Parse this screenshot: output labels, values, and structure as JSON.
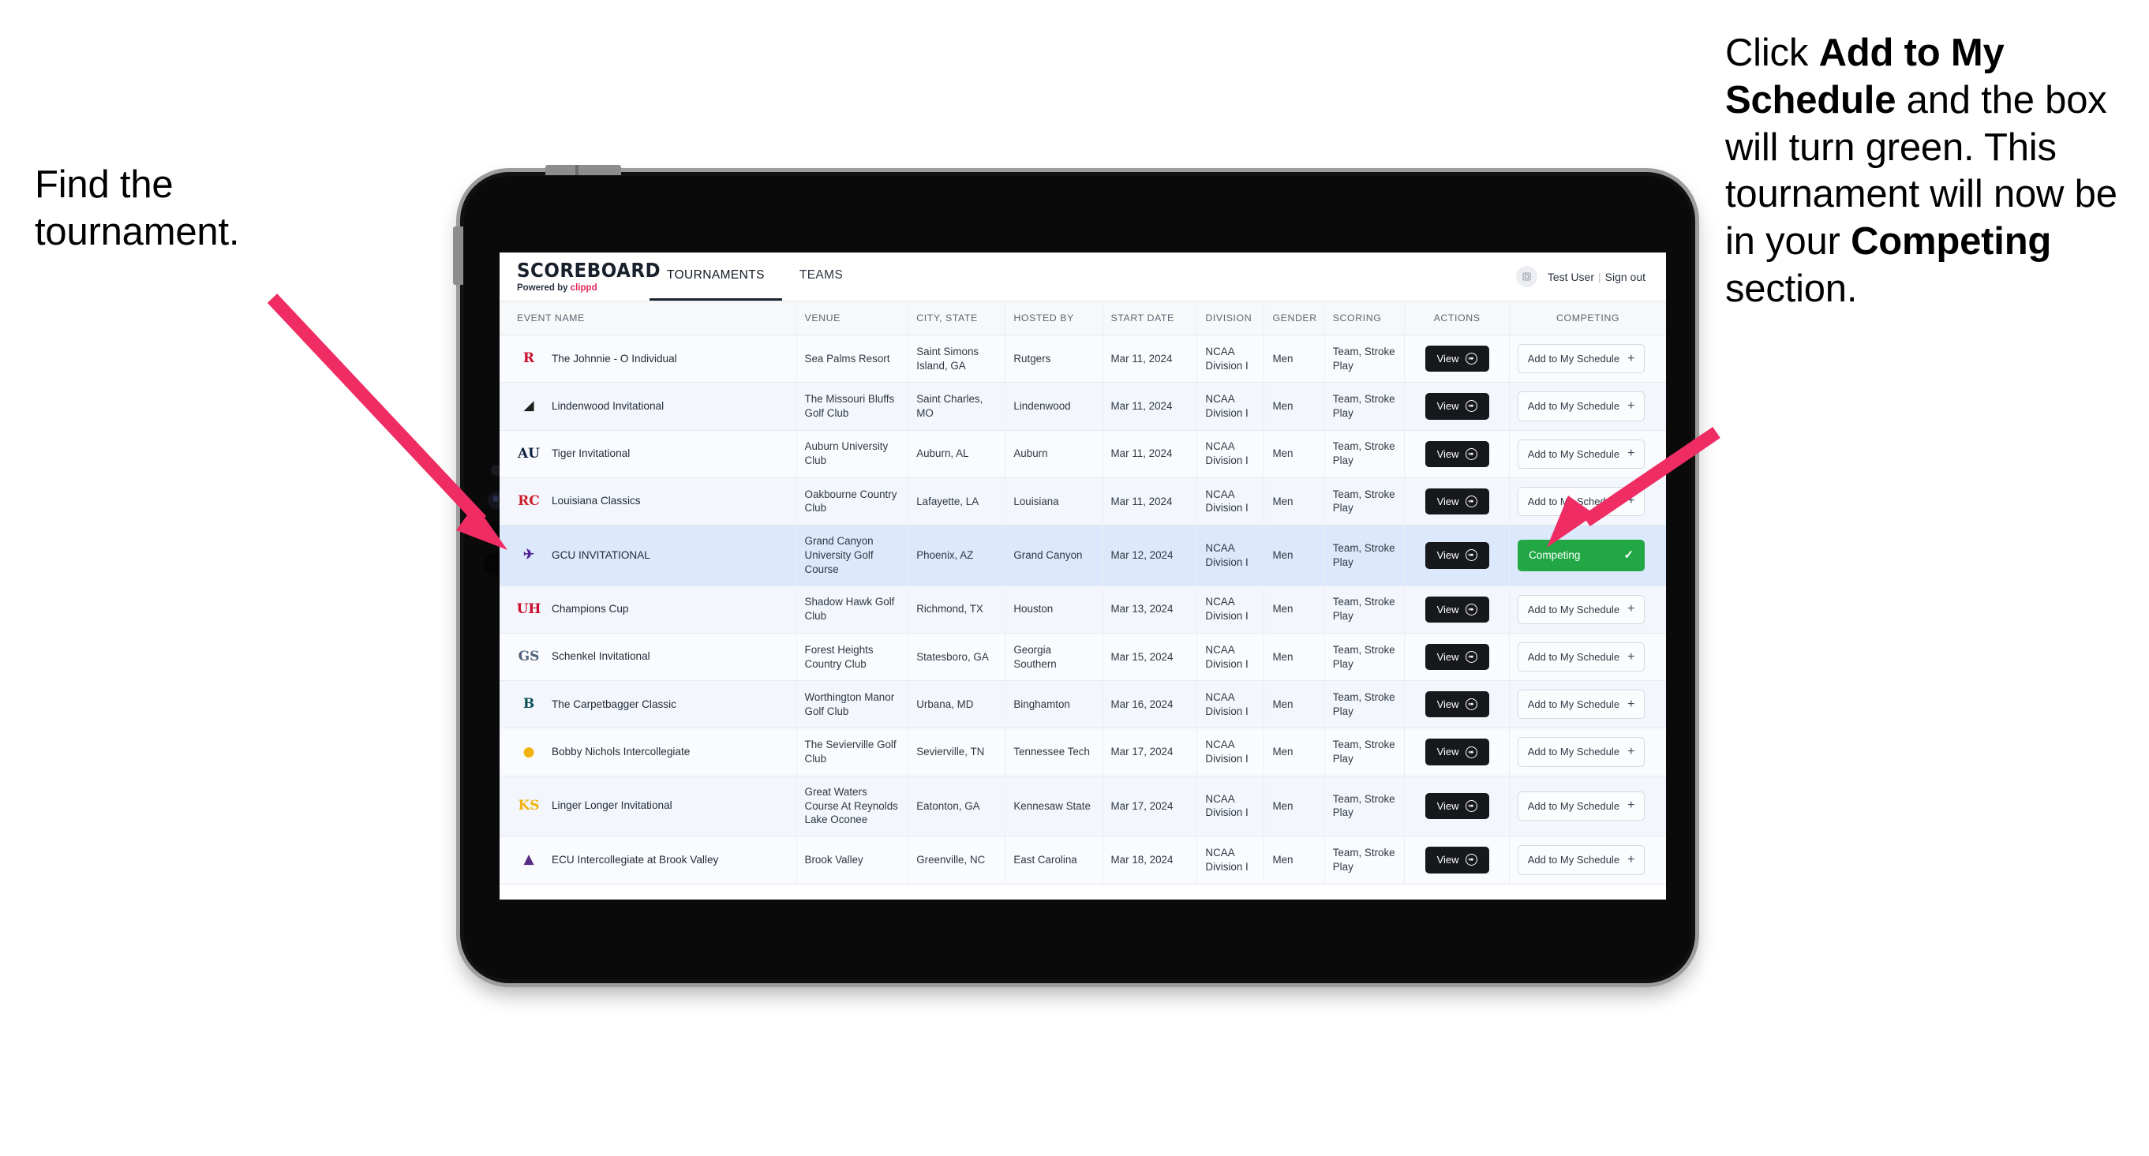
{
  "annotations": {
    "left": {
      "line1": "Find the",
      "line2": "tournament."
    },
    "right": {
      "pre": "Click ",
      "bold1": "Add to My Schedule",
      "mid": " and the box will turn green. This tournament will now be in your ",
      "bold2": "Competing",
      "post": " section."
    }
  },
  "app": {
    "brand": {
      "title": "SCOREBOARD",
      "powered_prefix": "Powered by ",
      "powered_name": "clippd"
    },
    "tabs": [
      {
        "label": "TOURNAMENTS",
        "active": true
      },
      {
        "label": "TEAMS",
        "active": false
      }
    ],
    "user": {
      "avatar_icon": "user-avatar-icon",
      "name": "Test User",
      "separator": "|",
      "sign_out": "Sign out"
    }
  },
  "table": {
    "columns": [
      "EVENT NAME",
      "VENUE",
      "CITY, STATE",
      "HOSTED BY",
      "START DATE",
      "DIVISION",
      "GENDER",
      "SCORING",
      "ACTIONS",
      "COMPETING"
    ],
    "action_label": "View",
    "add_label": "Add to My Schedule",
    "add_plus": "+",
    "competing_label": "Competing",
    "competing_check": "✓",
    "accent_green": "#22a745",
    "accent_pink": "#ef2c63",
    "selected_row_bg": "#dce8fb",
    "rows": [
      {
        "logo": {
          "text": "R",
          "color": "#c8102e",
          "bg": "transparent"
        },
        "event": "The Johnnie - O Individual",
        "venue": "Sea Palms Resort",
        "city": "Saint Simons Island, GA",
        "host": "Rutgers",
        "date": "Mar 11, 2024",
        "division": "NCAA Division I",
        "gender": "Men",
        "scoring": "Team, Stroke Play",
        "competing": false
      },
      {
        "logo": {
          "text": "◢",
          "color": "#1d1d1d",
          "bg": "transparent"
        },
        "event": "Lindenwood Invitational",
        "venue": "The Missouri Bluffs Golf Club",
        "city": "Saint Charles, MO",
        "host": "Lindenwood",
        "date": "Mar 11, 2024",
        "division": "NCAA Division I",
        "gender": "Men",
        "scoring": "Team, Stroke Play",
        "competing": false
      },
      {
        "logo": {
          "text": "AU",
          "color": "#0c2340",
          "bg": "transparent"
        },
        "event": "Tiger Invitational",
        "venue": "Auburn University Club",
        "city": "Auburn, AL",
        "host": "Auburn",
        "date": "Mar 11, 2024",
        "division": "NCAA Division I",
        "gender": "Men",
        "scoring": "Team, Stroke Play",
        "competing": false
      },
      {
        "logo": {
          "text": "RC",
          "color": "#ce2029",
          "bg": "transparent"
        },
        "event": "Louisiana Classics",
        "venue": "Oakbourne Country Club",
        "city": "Lafayette, LA",
        "host": "Louisiana",
        "date": "Mar 11, 2024",
        "division": "NCAA Division I",
        "gender": "Men",
        "scoring": "Team, Stroke Play",
        "competing": false
      },
      {
        "logo": {
          "text": "✈",
          "color": "#522398",
          "bg": "transparent"
        },
        "event": "GCU INVITATIONAL",
        "venue": "Grand Canyon University Golf Course",
        "city": "Phoenix, AZ",
        "host": "Grand Canyon",
        "date": "Mar 12, 2024",
        "division": "NCAA Division I",
        "gender": "Men",
        "scoring": "Team, Stroke Play",
        "competing": true,
        "selected": true
      },
      {
        "logo": {
          "text": "UH",
          "color": "#c8102e",
          "bg": "transparent"
        },
        "event": "Champions Cup",
        "venue": "Shadow Hawk Golf Club",
        "city": "Richmond, TX",
        "host": "Houston",
        "date": "Mar 13, 2024",
        "division": "NCAA Division I",
        "gender": "Men",
        "scoring": "Team, Stroke Play",
        "competing": false
      },
      {
        "logo": {
          "text": "GS",
          "color": "#4f6277",
          "bg": "transparent"
        },
        "event": "Schenkel Invitational",
        "venue": "Forest Heights Country Club",
        "city": "Statesboro, GA",
        "host": "Georgia Southern",
        "date": "Mar 15, 2024",
        "division": "NCAA Division I",
        "gender": "Men",
        "scoring": "Team, Stroke Play",
        "competing": false
      },
      {
        "logo": {
          "text": "B",
          "color": "#0d5257",
          "bg": "transparent"
        },
        "event": "The Carpetbagger Classic",
        "venue": "Worthington Manor Golf Club",
        "city": "Urbana, MD",
        "host": "Binghamton",
        "date": "Mar 16, 2024",
        "division": "NCAA Division I",
        "gender": "Men",
        "scoring": "Team, Stroke Play",
        "competing": false
      },
      {
        "logo": {
          "text": "●",
          "color": "#f0b310",
          "bg": "transparent"
        },
        "event": "Bobby Nichols Intercollegiate",
        "venue": "The Sevierville Golf Club",
        "city": "Sevierville, TN",
        "host": "Tennessee Tech",
        "date": "Mar 17, 2024",
        "division": "NCAA Division I",
        "gender": "Men",
        "scoring": "Team, Stroke Play",
        "competing": false
      },
      {
        "logo": {
          "text": "KS",
          "color": "#f0b310",
          "bg": "transparent"
        },
        "event": "Linger Longer Invitational",
        "venue": "Great Waters Course At Reynolds Lake Oconee",
        "city": "Eatonton, GA",
        "host": "Kennesaw State",
        "date": "Mar 17, 2024",
        "division": "NCAA Division I",
        "gender": "Men",
        "scoring": "Team, Stroke Play",
        "competing": false
      },
      {
        "logo": {
          "text": "▲",
          "color": "#582c83",
          "bg": "transparent"
        },
        "event": "ECU Intercollegiate at Brook Valley",
        "venue": "Brook Valley",
        "city": "Greenville, NC",
        "host": "East Carolina",
        "date": "Mar 18, 2024",
        "division": "NCAA Division I",
        "gender": "Men",
        "scoring": "Team, Stroke Play",
        "competing": false,
        "clipped": true
      }
    ]
  }
}
